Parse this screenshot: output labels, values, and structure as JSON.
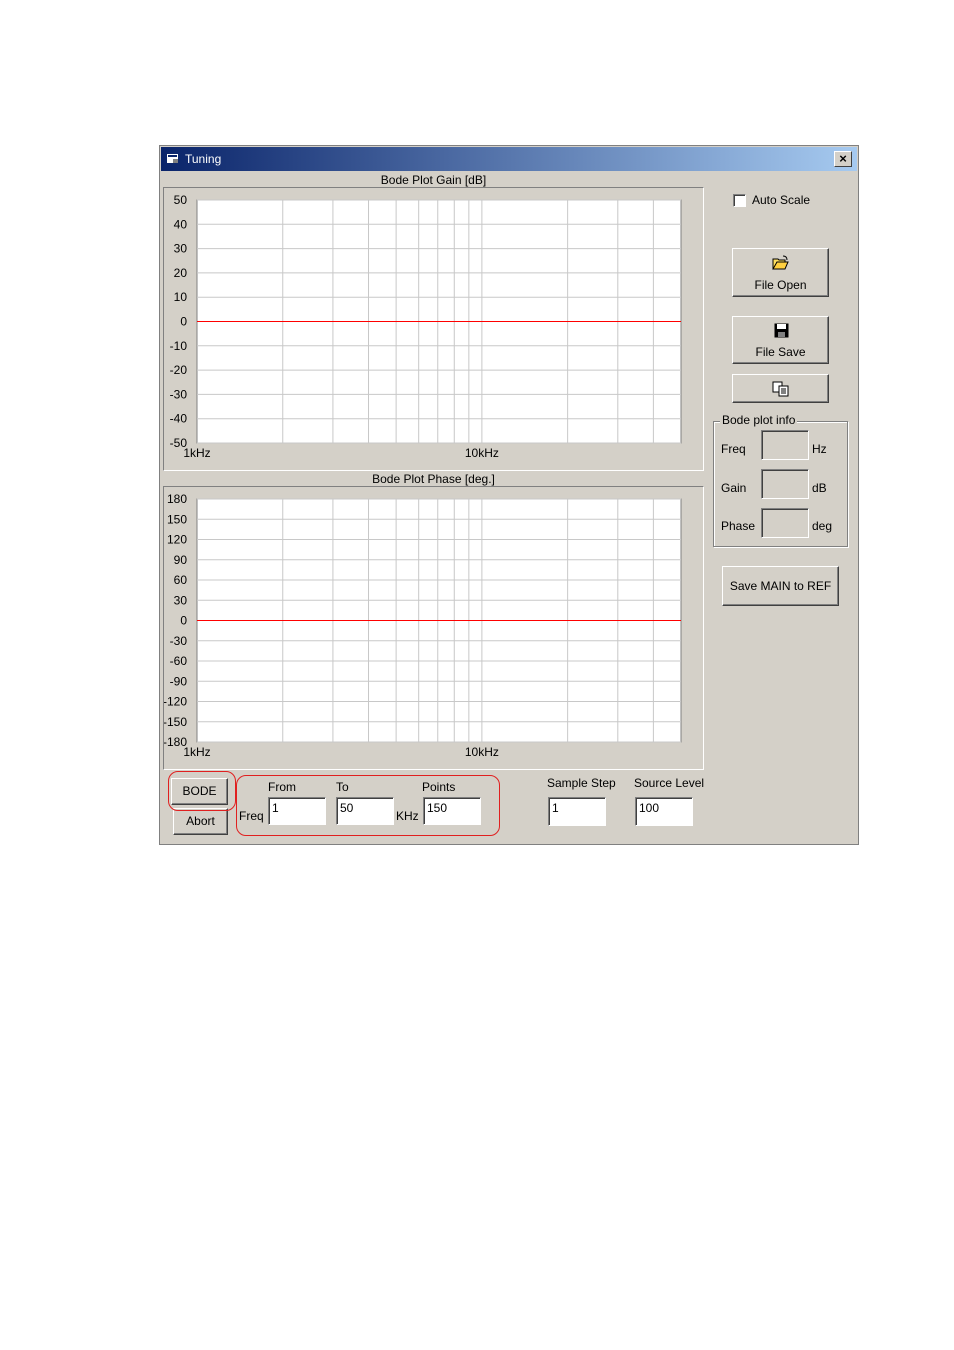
{
  "window": {
    "title": "Tuning",
    "close_label": "×"
  },
  "gain_chart": {
    "title": "Bode Plot Gain [dB]",
    "y_ticks": [
      "50",
      "40",
      "30",
      "20",
      "10",
      "0",
      "-10",
      "-20",
      "-30",
      "-40",
      "-50"
    ],
    "x_labels": [
      "1kHz",
      "10kHz"
    ]
  },
  "phase_chart": {
    "title": "Bode Plot Phase [deg.]",
    "y_ticks": [
      "180",
      "150",
      "120",
      "90",
      "60",
      "30",
      "0",
      "-30",
      "-60",
      "-90",
      "-120",
      "-150",
      "-180"
    ],
    "x_labels": [
      "1kHz",
      "10kHz"
    ]
  },
  "chart_data": [
    {
      "type": "line",
      "title": "Bode Plot Gain [dB]",
      "xlabel": "",
      "ylabel": "",
      "x_scale": "log",
      "xlim": [
        1,
        50
      ],
      "ylim": [
        -50,
        50
      ],
      "x_tick_labels": [
        "1kHz",
        "10kHz"
      ],
      "series": [
        {
          "x": [
            1,
            50
          ],
          "y": [
            0,
            0
          ],
          "color": "#ff0000"
        }
      ],
      "grid": true
    },
    {
      "type": "line",
      "title": "Bode Plot Phase [deg.]",
      "xlabel": "",
      "ylabel": "",
      "x_scale": "log",
      "xlim": [
        1,
        50
      ],
      "ylim": [
        -180,
        180
      ],
      "x_tick_labels": [
        "1kHz",
        "10kHz"
      ],
      "series": [
        {
          "x": [
            1,
            50
          ],
          "y": [
            0,
            0
          ],
          "color": "#ff0000"
        }
      ],
      "grid": true
    }
  ],
  "sidebar": {
    "auto_scale_label": "Auto Scale",
    "auto_scale_checked": false,
    "file_open_label": "File Open",
    "file_save_label": "File Save",
    "info_group_title": "Bode plot info",
    "freq_label": "Freq",
    "freq_unit": "Hz",
    "gain_label": "Gain",
    "gain_unit": "dB",
    "phase_label": "Phase",
    "phase_unit": "deg",
    "save_ref_label": "Save MAIN to REF"
  },
  "controls": {
    "bode_label": "BODE",
    "abort_label": "Abort",
    "from_label": "From",
    "to_label": "To",
    "points_label": "Points",
    "freq_label": "Freq",
    "khz_label": "KHz",
    "from_value": "1",
    "to_value": "50",
    "points_value": "150",
    "sample_step_label": "Sample Step",
    "sample_step_value": "1",
    "source_level_label": "Source Level",
    "source_level_value": "100"
  },
  "colors": {
    "trace": "#ff0000",
    "grid": "#c8c8c8",
    "highlight": "#e02020",
    "titlebar_start": "#0a246a",
    "titlebar_end": "#a6caf0"
  }
}
